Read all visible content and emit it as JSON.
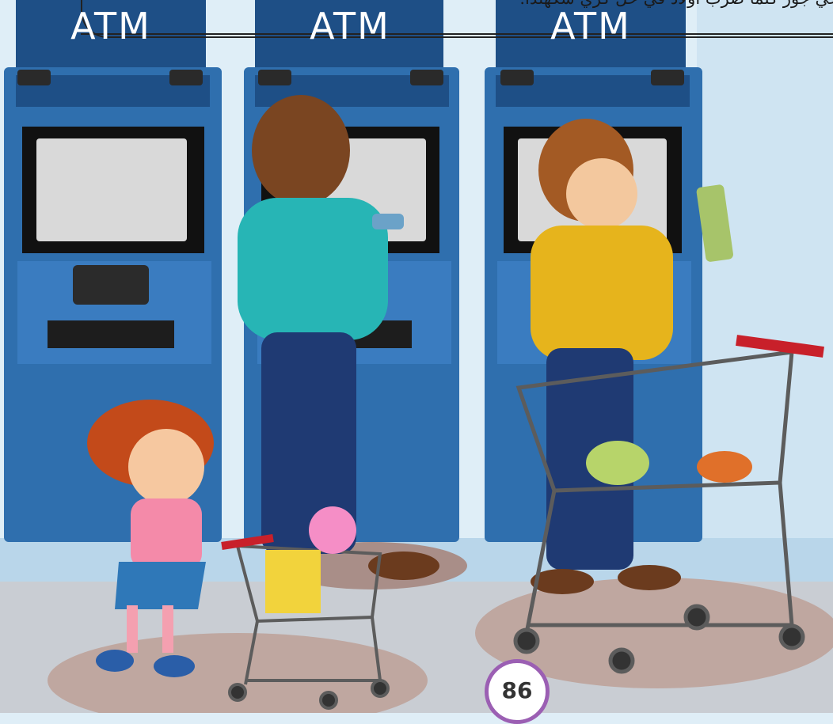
{
  "caption": {
    "text": "جي جور كلما ضرب أولاد في حل كري سكهلدا."
  },
  "atms": [
    {
      "label": "ATM"
    },
    {
      "label": "ATM"
    },
    {
      "label": "ATM"
    }
  ],
  "page": {
    "number": "86"
  },
  "colors": {
    "wall": "#dfeef7",
    "atm_body": "#2f6fae",
    "atm_top": "#1e4f86",
    "floor": "#c9cdd3",
    "badge_ring": "#9b5fb3"
  }
}
